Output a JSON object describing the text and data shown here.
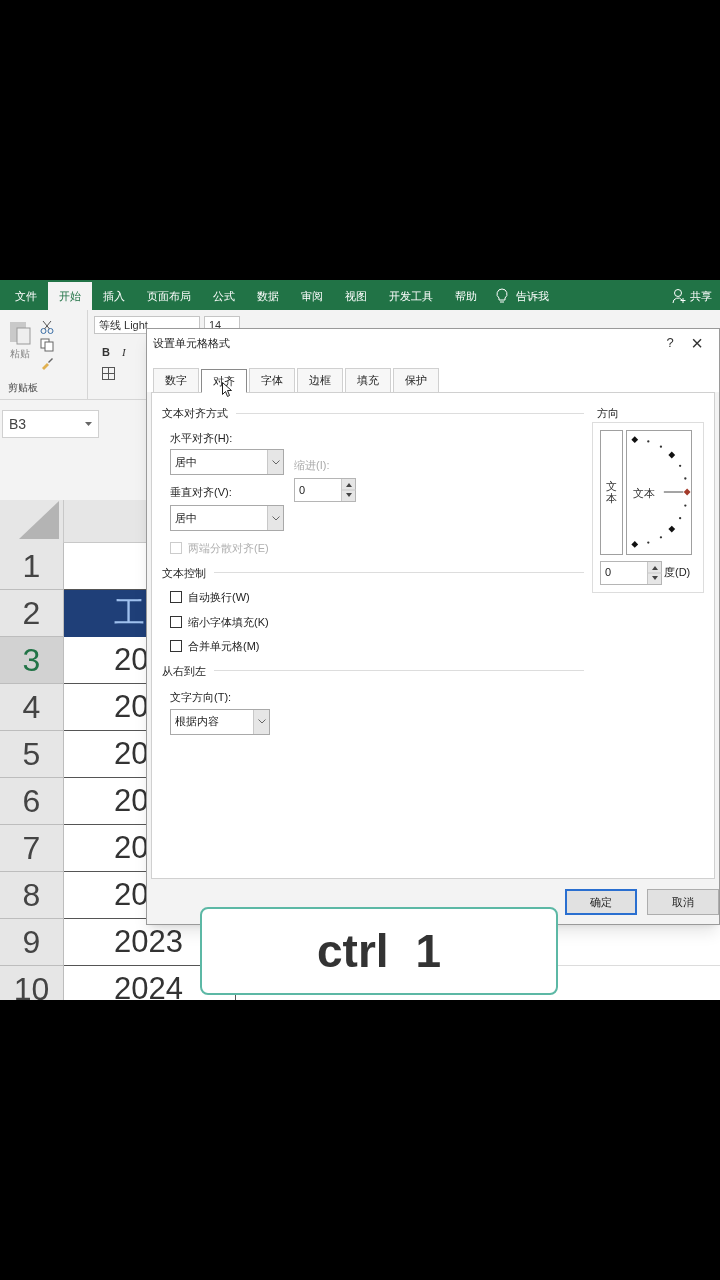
{
  "ribbon_tabs": [
    {
      "label": "文件",
      "selected": false
    },
    {
      "label": "开始",
      "selected": true
    },
    {
      "label": "插入",
      "selected": false
    },
    {
      "label": "页面布局",
      "selected": false
    },
    {
      "label": "公式",
      "selected": false
    },
    {
      "label": "数据",
      "selected": false
    },
    {
      "label": "审阅",
      "selected": false
    },
    {
      "label": "视图",
      "selected": false
    },
    {
      "label": "开发工具",
      "selected": false
    },
    {
      "label": "帮助",
      "selected": false
    }
  ],
  "tell_me": "告诉我",
  "share": "共享",
  "ribbon": {
    "paste": "粘贴",
    "clipboard_group": "剪贴板",
    "font_name": "等线 Light",
    "font_size": "14",
    "bold": "B",
    "italic": "I"
  },
  "name_box": "B3",
  "rows": [
    {
      "number": "1",
      "selected": false,
      "kind": "plain"
    },
    {
      "number": "2",
      "selected": false,
      "kind": "header",
      "value": "工"
    },
    {
      "number": "3",
      "selected": true,
      "kind": "plain",
      "value": "20"
    },
    {
      "number": "4",
      "selected": false,
      "kind": "plain",
      "value": "20"
    },
    {
      "number": "5",
      "selected": false,
      "kind": "plain",
      "value": "20"
    },
    {
      "number": "6",
      "selected": false,
      "kind": "plain",
      "value": "20"
    },
    {
      "number": "7",
      "selected": false,
      "kind": "plain",
      "value": "20"
    },
    {
      "number": "8",
      "selected": false,
      "kind": "plain",
      "value": "20"
    },
    {
      "number": "9",
      "selected": false,
      "kind": "plain",
      "value": "2023"
    },
    {
      "number": "10",
      "selected": false,
      "kind": "plain",
      "value": "2024"
    }
  ],
  "dialog": {
    "title": "设置单元格格式",
    "help": "?",
    "close": "×",
    "tabs": [
      {
        "label": "数字",
        "selected": false
      },
      {
        "label": "对齐",
        "selected": true
      },
      {
        "label": "字体",
        "selected": false
      },
      {
        "label": "边框",
        "selected": false
      },
      {
        "label": "填充",
        "selected": false
      },
      {
        "label": "保护",
        "selected": false
      }
    ],
    "alignment": {
      "title": "文本对齐方式",
      "horizontal_label": "水平对齐(H):",
      "horizontal_value": "居中",
      "vertical_label": "垂直对齐(V):",
      "vertical_value": "居中",
      "indent_label": "缩进(I):",
      "indent_value": "0",
      "indent_disabled": true,
      "distributed": {
        "label": "两端分散对齐(E)",
        "checked": false,
        "disabled": true
      }
    },
    "text_control": {
      "title": "文本控制",
      "options": [
        {
          "label": "自动换行(W)",
          "checked": false
        },
        {
          "label": "缩小字体填充(K)",
          "checked": false
        },
        {
          "label": "合并单元格(M)",
          "checked": false
        }
      ]
    },
    "rtl": {
      "title": "从右到左",
      "direction_label": "文字方向(T):",
      "direction_value": "根据内容"
    },
    "orientation": {
      "title": "方向",
      "vertical_text": "文本",
      "dial_text": "文本",
      "degrees": "0",
      "degrees_label": "度(D)"
    },
    "buttons": [
      {
        "label": "确定",
        "default": true
      },
      {
        "label": "取消",
        "default": false
      }
    ]
  },
  "key_hint": "ctrl 1"
}
